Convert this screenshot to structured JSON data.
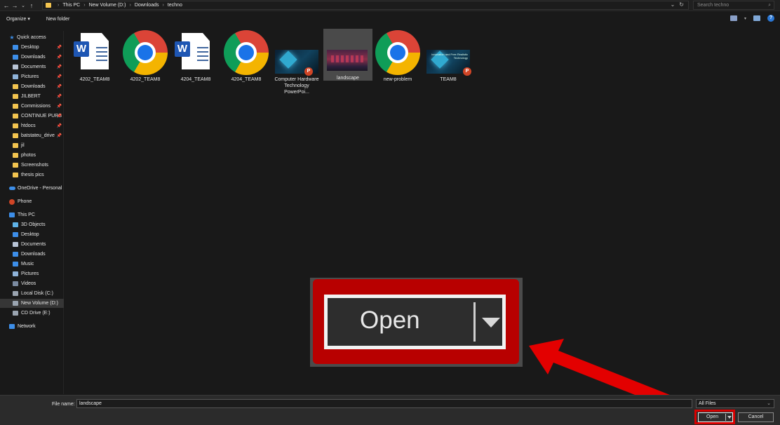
{
  "address": {
    "crumbs": [
      "This PC",
      "New Volume (D:)",
      "Downloads",
      "techno"
    ],
    "search_placeholder": "Search techno"
  },
  "toolbar": {
    "organize": "Organize ▾",
    "new_folder": "New folder"
  },
  "sidebar": {
    "quick_access": "Quick access",
    "quick_items": [
      "Desktop",
      "Downloads",
      "Documents",
      "Pictures",
      "Downloads",
      "JILBERT",
      "Commissions",
      "CONTINUE PURS",
      "htdocs",
      "batstateu_drive",
      "jil",
      "photos",
      "Screenshots",
      "thesis pics"
    ],
    "onedrive": "OneDrive - Personal",
    "phone": "Phone",
    "this_pc": "This PC",
    "pc_items": [
      "3D Objects",
      "Desktop",
      "Documents",
      "Downloads",
      "Music",
      "Pictures",
      "Videos",
      "Local Disk (C:)",
      "New Volume (D:)",
      "CD Drive (E:)"
    ],
    "network": "Network"
  },
  "files": [
    {
      "name": "4202_TEAM8",
      "kind": "word"
    },
    {
      "name": "4202_TEAM8",
      "kind": "chrome"
    },
    {
      "name": "4204_TEAM8",
      "kind": "word"
    },
    {
      "name": "4204_TEAM8",
      "kind": "chrome"
    },
    {
      "name": "Computer Hardware Technology PowerPoi...",
      "kind": "ppt"
    },
    {
      "name": "landscape",
      "kind": "image"
    },
    {
      "name": "new-problem",
      "kind": "chrome"
    },
    {
      "name": "TEAM8",
      "kind": "ppt"
    }
  ],
  "ppt_thumb_text": "Innovation and Free Realistic Technology",
  "footer": {
    "file_name_label": "File name:",
    "file_name_value": "landscape",
    "filter_value": "All Files",
    "open_label": "Open",
    "cancel_label": "Cancel"
  },
  "callout": {
    "label": "Open"
  },
  "colors": {
    "annotation_red": "#d80000",
    "folder_yellow": "#f3c44f",
    "accent_blue": "#3d8ee8"
  }
}
